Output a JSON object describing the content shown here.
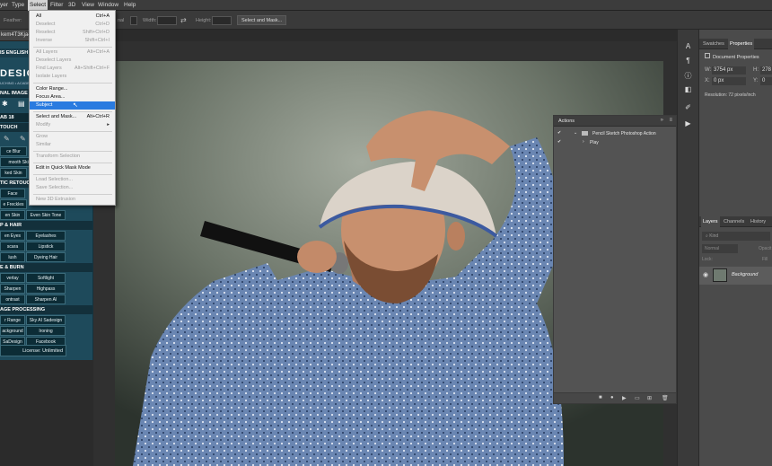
{
  "menubar": {
    "items": [
      "yer",
      "Type",
      "Select",
      "Filter",
      "3D",
      "View",
      "Window",
      "Help"
    ],
    "active": "Select"
  },
  "options_bar": {
    "feather_label": "Feather:",
    "width_label": "Width:",
    "height_label": "Height:",
    "select_mask_button": "Select and Mask...",
    "style_value": "nal"
  },
  "document_tab": "kem4T3Kja4",
  "select_menu": {
    "items": [
      {
        "label": "All",
        "shortcut": "Ctrl+A",
        "enabled": true
      },
      {
        "label": "Deselect",
        "shortcut": "Ctrl+D",
        "enabled": false
      },
      {
        "label": "Reselect",
        "shortcut": "Shift+Ctrl+D",
        "enabled": false
      },
      {
        "label": "Inverse",
        "shortcut": "Shift+Ctrl+I",
        "enabled": false
      },
      {
        "label": "All Layers",
        "shortcut": "Alt+Ctrl+A",
        "enabled": false
      },
      {
        "label": "Deselect Layers",
        "shortcut": "",
        "enabled": false
      },
      {
        "label": "Find Layers",
        "shortcut": "Alt+Shift+Ctrl+F",
        "enabled": false
      },
      {
        "label": "Isolate Layers",
        "shortcut": "",
        "enabled": false
      },
      {
        "label": "Color Range...",
        "shortcut": "",
        "enabled": true
      },
      {
        "label": "Focus Area...",
        "shortcut": "",
        "enabled": true
      },
      {
        "label": "Subject",
        "shortcut": "",
        "enabled": true,
        "highlighted": true
      },
      {
        "label": "Select and Mask...",
        "shortcut": "Alt+Ctrl+R",
        "enabled": true
      },
      {
        "label": "Modify",
        "shortcut": "",
        "enabled": false,
        "submenu": true
      },
      {
        "label": "Grow",
        "shortcut": "",
        "enabled": false
      },
      {
        "label": "Similar",
        "shortcut": "",
        "enabled": false
      },
      {
        "label": "Transform Selection",
        "shortcut": "",
        "enabled": false
      },
      {
        "label": "Edit in Quick Mask Mode",
        "shortcut": "",
        "enabled": true
      },
      {
        "label": "Load Selection...",
        "shortcut": "",
        "enabled": false
      },
      {
        "label": "Save Selection...",
        "shortcut": "",
        "enabled": false
      },
      {
        "label": "New 3D Extrusion",
        "shortcut": "",
        "enabled": false
      }
    ]
  },
  "plugin_panel": {
    "lang": "IS ENGLISH",
    "logo": "DESIG",
    "logo_sub": "UCHING • ACADE",
    "sections": [
      "NAL IMAGE",
      "AB 18",
      "TOUCH",
      "TIC RETOUCH",
      "P & HAIR",
      "E & BURN",
      "AGE PROCESSING"
    ],
    "buttons": [
      "ce Blur",
      "mooth Skin",
      "ked Skin",
      "Face",
      "e Freckles",
      "en Skin",
      "Even Skin Tone",
      "en Eyes",
      "Eyelashes",
      "scara",
      "Lipstick",
      "lush",
      "Dyeing Hair",
      "verlay",
      "Softlight",
      "Sharpen",
      "Highpass",
      "ontrast",
      "Sharpen AI",
      "r Range",
      "Sky AI Sadesign",
      "ackground",
      "Ironing",
      "SaDesign",
      "Facebook"
    ],
    "license": "License: Unlimited"
  },
  "actions_panel": {
    "title": "Actions",
    "set_name": "Pencil Sketch Photoshop Action",
    "action_name": "Play"
  },
  "right_panel": {
    "tabs_top": [
      "Swatches",
      "Properties"
    ],
    "active_top": "Properties",
    "doc_props_title": "Document Properties",
    "w_label": "W:",
    "w_value": "3754 px",
    "h_label": "H:",
    "h_value": "278",
    "x_label": "X:",
    "x_value": "0 px",
    "y_label": "Y:",
    "y_value": "0",
    "resolution": "Resolution: 72 pixels/inch",
    "tabs_bottom": [
      "Layers",
      "Channels",
      "History"
    ],
    "active_bottom": "Layers",
    "kind_placeholder": "Kind",
    "blend_mode": "Normal",
    "opacity_label": "Opacit",
    "lock_label": "Lock:",
    "fill_label": "Fill",
    "layer_name": "Background"
  },
  "colors": {
    "plugin_bg": "#1e4a5b",
    "menu_highlight": "#2a7be0",
    "panel_bg": "#535353"
  }
}
